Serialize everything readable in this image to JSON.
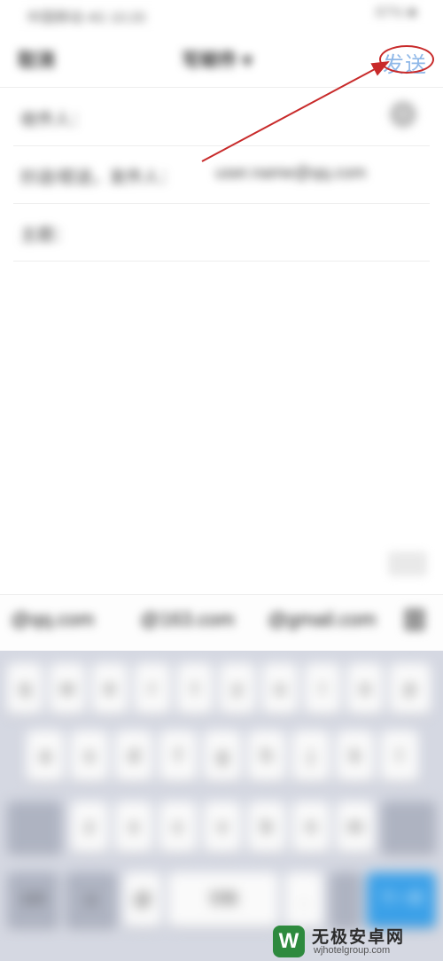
{
  "status_bar": {
    "left_text": "中国移动 4G 10:20",
    "right_text": "87% ■"
  },
  "header": {
    "cancel_label": "取消",
    "title": "写邮件 ▾",
    "send_label": "发送"
  },
  "compose": {
    "to_label": "收件人：",
    "cc_label": "抄送/密送，发件人：",
    "from_value": "user.name@qq.com",
    "subject_label": "主题：",
    "plus_icon": "+"
  },
  "suggestions": [
    "@qq.com",
    "@163.com",
    "@gmail.com"
  ],
  "keyboard": {
    "row1": [
      "q",
      "w",
      "e",
      "r",
      "t",
      "y",
      "u",
      "i",
      "o",
      "p"
    ],
    "row2": [
      "a",
      "s",
      "d",
      "f",
      "g",
      "h",
      "j",
      "k",
      "l"
    ],
    "row3": [
      "z",
      "x",
      "c",
      "v",
      "b",
      "n",
      "m"
    ],
    "bottom": {
      "sym": "123",
      "emoji": "☺",
      "at": "@",
      "space": "空格",
      "dot": ".",
      "next": "下一项"
    }
  },
  "watermark": {
    "logo": "W",
    "title": "无极安卓网",
    "url": "wjhotelgroup.com"
  },
  "colors": {
    "annotation": "#c82a2a",
    "send_disabled": "#8fb8e8",
    "keyboard_bg": "#d5d8e2",
    "accent_key": "#3aa0e8"
  }
}
